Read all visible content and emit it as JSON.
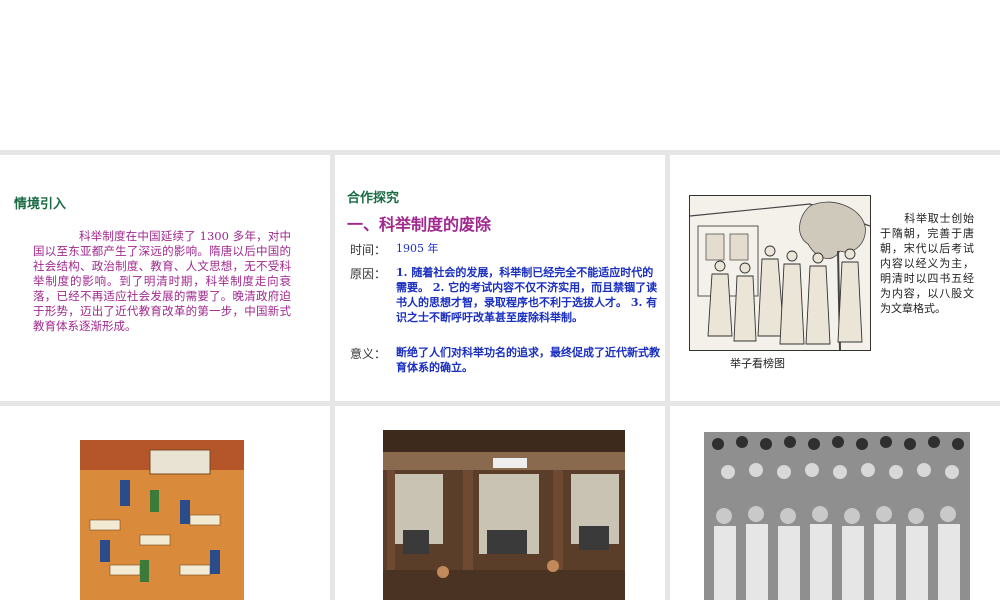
{
  "slide1": {
    "heading": "情境引入",
    "body": "科举制度在中国延续了 1300 多年，对中国以至东亚都产生了深远的影响。隋唐以后中国的社会结构、政治制度、教育、人文思想，无不受科举制度的影响。到了明清时期，科举制度走向衰落，已经不再适应社会发展的需要了。晚清政府迫于形势，迈出了近代教育改革的第一步，中国新式教育体系逐渐形成。"
  },
  "slide2": {
    "heading": "合作探究",
    "title": "一、科举制度的废除",
    "time_label": "时间：",
    "time_value": "1905 年",
    "reason_label": "原因：",
    "reason_value": "1. 随着社会的发展，科举制已经完全不能适应时代的需要。 2. 它的考试内容不仅不济实用，而且禁锢了读书人的思想才智，录取程序也不利于选拔人才。 3. 有识之士不断呼吁改革甚至废除科举制。",
    "meaning_label": "意义：",
    "meaning_value": "断绝了人们对科举功名的追求，最终促成了近代新式教育体系的确立。"
  },
  "slide3": {
    "caption": "举子看榜图",
    "side_text": "科举取士创始于隋朝，完善于唐朝，宋代以后考试内容以经义为主，明清时以四书五经为内容，以八股文为文章格式。"
  },
  "colors": {
    "green": "#1a6b44",
    "purple": "#a0288f",
    "blue": "#1a2fc0"
  }
}
